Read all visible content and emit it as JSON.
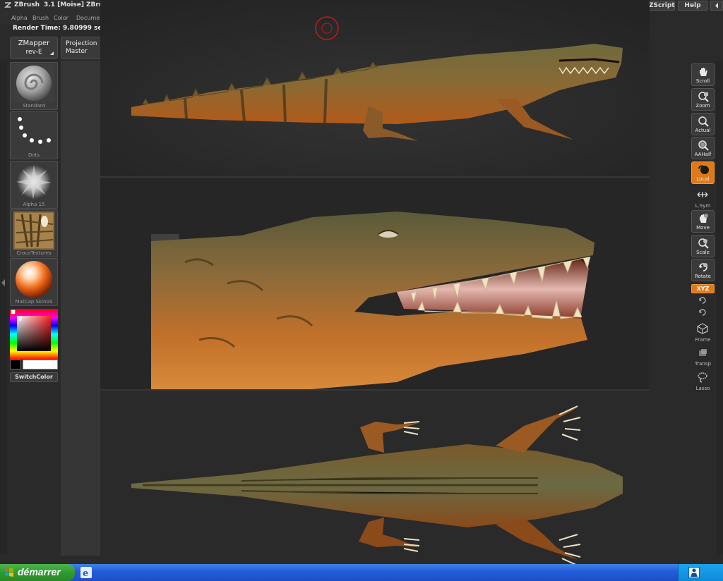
{
  "titlebar": {
    "app": "ZBrush",
    "version": "3.1 [Moise]",
    "menu_truncated": "ZBru",
    "zscript": "ZScript",
    "help": "Help"
  },
  "menus": [
    "Alpha",
    "Brush",
    "Color",
    "Documen"
  ],
  "info": {
    "render_time": "Render Time: 9.80999 se"
  },
  "left_buttons": {
    "zmapper_line1": "ZMapper",
    "zmapper_line2": "rev-E",
    "projection_line1": "Projection",
    "projection_line2": "Master"
  },
  "slots": [
    {
      "label": "Standard",
      "icon": "standard-brush-icon"
    },
    {
      "label": "Dots",
      "icon": "dots-stroke-icon"
    },
    {
      "label": "Alpha 15",
      "icon": "alpha-icon"
    },
    {
      "label": "CrocoTextures",
      "icon": "texture-icon"
    },
    {
      "label": "MatCap Skin04",
      "icon": "matcap-sphere-icon"
    }
  ],
  "switch_color": "SwitchColor",
  "right_tools": [
    {
      "label": "Scroll",
      "icon": "hand-icon",
      "active": false
    },
    {
      "label": "Zoom",
      "icon": "zoom-icon",
      "active": false
    },
    {
      "label": "Actual",
      "icon": "actual-icon",
      "active": false
    },
    {
      "label": "AAHalf",
      "icon": "aahalf-icon",
      "active": false
    },
    {
      "label": "Local",
      "icon": "local-icon",
      "active": true
    },
    {
      "label": "L.Sym",
      "icon": "lsym-icon",
      "active": false
    },
    {
      "label": "Move",
      "icon": "move-icon",
      "active": false
    },
    {
      "label": "Scale",
      "icon": "scale-icon",
      "active": false
    },
    {
      "label": "Rotate",
      "icon": "rotate-icon",
      "active": false
    }
  ],
  "xyz": "XYZ",
  "right_lower": [
    {
      "label": "Frame",
      "icon": "frame-icon"
    },
    {
      "label": "Transp",
      "icon": "transp-icon"
    },
    {
      "label": "Lasso",
      "icon": "lasso-icon"
    }
  ],
  "taskbar": {
    "start": "démarrer"
  },
  "colors": {
    "accent": "#e07a18",
    "panel": "#2a2a2a",
    "taskbar": "#245edb",
    "start": "#2f9a2f"
  }
}
